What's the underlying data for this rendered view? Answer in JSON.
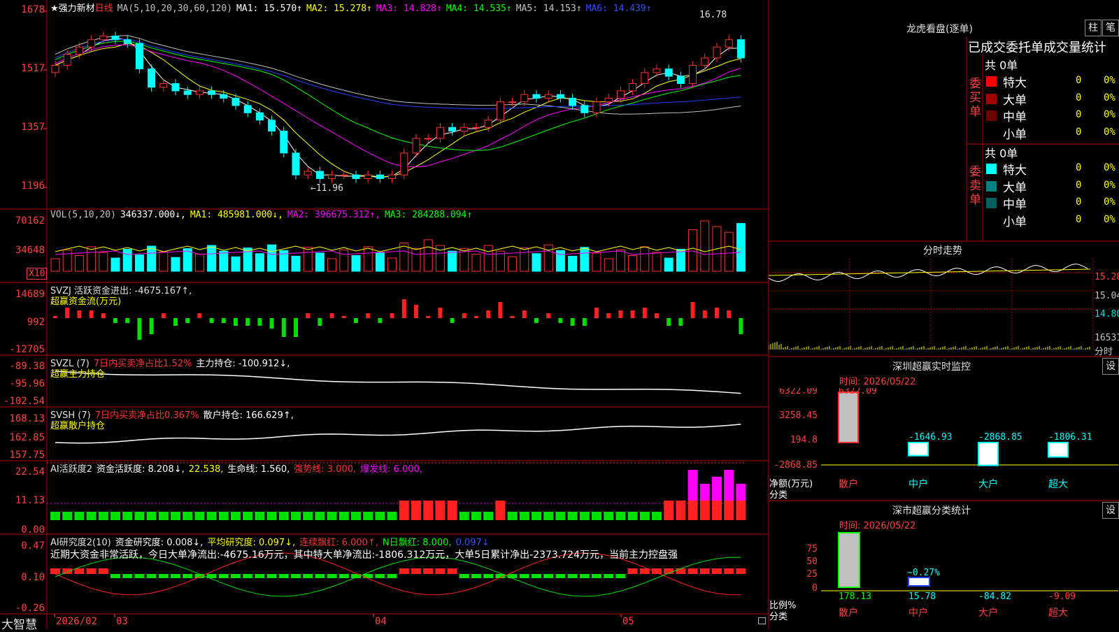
{
  "stock": {
    "name": "★强力新材",
    "period": "日线",
    "ma_label": "MA(5,10,20,30,60,120)",
    "ma_values": [
      {
        "label": "MA1: 15.570↑",
        "color": "#ffffff"
      },
      {
        "label": "MA2: 15.278↑",
        "color": "#ffff00"
      },
      {
        "label": "MA3: 14.828↑",
        "color": "#ff00ff"
      },
      {
        "label": "MA4: 14.535↑",
        "color": "#00ff00"
      },
      {
        "label": "MA5: 14.153↑",
        "color": "#c0c0c0"
      },
      {
        "label": "MA6: 14.439↑",
        "color": "#2040ff"
      }
    ],
    "price_axis": [
      "1678",
      "1517",
      "1357",
      "1196"
    ],
    "high_mark": "16.78",
    "low_mark": "11.96"
  },
  "vol": {
    "legend": "VOL(5,10,20)",
    "vol_value": "346337.000↓,",
    "ma1": "MA1: 485981.000↓,",
    "ma2": "MA2: 396675.312↑,",
    "ma3": "MA3: 284288.094↑",
    "axis": [
      "70162",
      "34648"
    ],
    "unit": "X10"
  },
  "svzj": {
    "legend_a": "SVZJ  活跃资金进出: -4675.167↑,",
    "legend_b": "超赢资金流(万元)",
    "axis": [
      "14689",
      "992",
      "-12705"
    ]
  },
  "svzl": {
    "legend_a": "SVZL (7)",
    "legend_b": "7日内买卖净占比1.52%",
    "legend_c": "主力持仓: -100.912↓,",
    "legend_d": "超赢主力持仓",
    "axis": [
      "-89.38",
      "-95.96",
      "-102.54"
    ]
  },
  "svsh": {
    "legend_a": "SVSH (7)",
    "legend_b": "7日内买卖净占比0.367%",
    "legend_c": "散户持仓: 166.629↑,",
    "legend_d": "超赢散户持仓",
    "axis": [
      "168.13",
      "162.85",
      "157.75"
    ]
  },
  "ai1": {
    "legend_a": "AI活跃度2",
    "legend_b": "资金活跃度: 8.208↓,",
    "legend_c": "22.538,",
    "legend_d": "生命线: 1.560,",
    "legend_e": "强势线: 3.000,",
    "legend_f": "爆发线: 6.000,",
    "axis": [
      "22.54",
      "11.13",
      "0.00"
    ]
  },
  "ai2": {
    "legend_a": "AI研究度2(10)",
    "legend_b": "资金研究度: 0.008↓,",
    "legend_c": "平均研究度: 0.097↓,",
    "legend_d": "连续飘红: 6.000↑,",
    "legend_e": "N日飘红: 8.000,",
    "legend_f": "0.097↓",
    "comment": "近期大资金非常活跃，今日大单净流出:-4675.16万元，其中特大单净流出:-1806.312万元，大单5日累计净出-2373.724万元，当前主力控盘强",
    "axis": [
      "0.47",
      "0.10",
      "-0.26"
    ]
  },
  "footer": {
    "brand": "大智慧",
    "dates": [
      "2026/02",
      "03",
      "04",
      "05"
    ]
  },
  "dragon": {
    "title": "龙虎看盘(逐单)",
    "btn1": "柱",
    "btn2": "笔",
    "tabs": "已成交委托单成交量统计",
    "buy_label": "委买单",
    "sell_label": "委卖单",
    "buy_total": "共 0单",
    "sell_total": "共 0单",
    "buy_rows": [
      {
        "name": "特大",
        "color": "#ff0000",
        "n": "0",
        "pct": "0%"
      },
      {
        "name": "大单",
        "color": "#a00000",
        "n": "0",
        "pct": "0%"
      },
      {
        "name": "中单",
        "color": "#700000",
        "n": "0",
        "pct": "0%"
      },
      {
        "name": "小单",
        "color": "#000000",
        "n": "0",
        "pct": "0%"
      }
    ],
    "sell_rows": [
      {
        "name": "特大",
        "color": "#00ffff",
        "n": "0",
        "pct": "0%"
      },
      {
        "name": "大单",
        "color": "#008080",
        "n": "0",
        "pct": "0%"
      },
      {
        "name": "中单",
        "color": "#006060",
        "n": "0",
        "pct": "0%"
      },
      {
        "name": "小单",
        "color": "#000000",
        "n": "0",
        "pct": "0%"
      }
    ]
  },
  "intraday": {
    "title": "分时走势",
    "axis": [
      "15.28",
      "15.04",
      "14.80",
      "16531"
    ],
    "unit": "分时"
  },
  "sz_monitor": {
    "title": "深圳超赢实时监控",
    "btn": "设",
    "time": "时间: 2026/05/22",
    "axis": [
      "6322.09",
      "3258.45",
      "194.8",
      "-2868.85"
    ],
    "ylabel": "净额(万元)",
    "xlabel": "分类",
    "cats": [
      "散户",
      "中户",
      "大户",
      "超大"
    ],
    "values": [
      "6322.09",
      "-1646.93",
      "-2868.85",
      "-1806.31"
    ]
  },
  "sz_class": {
    "title": "深市超赢分类统计",
    "btn": "设",
    "time": "时间: 2026/05/22",
    "axis": [
      "75",
      "50",
      "25",
      "0"
    ],
    "ylabel": "比例%",
    "xlabel": "分类",
    "cats": [
      "散户",
      "中户",
      "大户",
      "超大"
    ],
    "values": [
      "178.13",
      "15.78",
      "-84.82",
      "-9.09"
    ],
    "bar_note": "0.27%"
  },
  "chart_data": {
    "type": "bar",
    "title": "深圳超赢实时监控",
    "categories": [
      "散户",
      "中户",
      "大户",
      "超大"
    ],
    "values": [
      6322.09,
      -1646.93,
      -2868.85,
      -1806.31
    ],
    "ylabel": "净额(万元)"
  }
}
